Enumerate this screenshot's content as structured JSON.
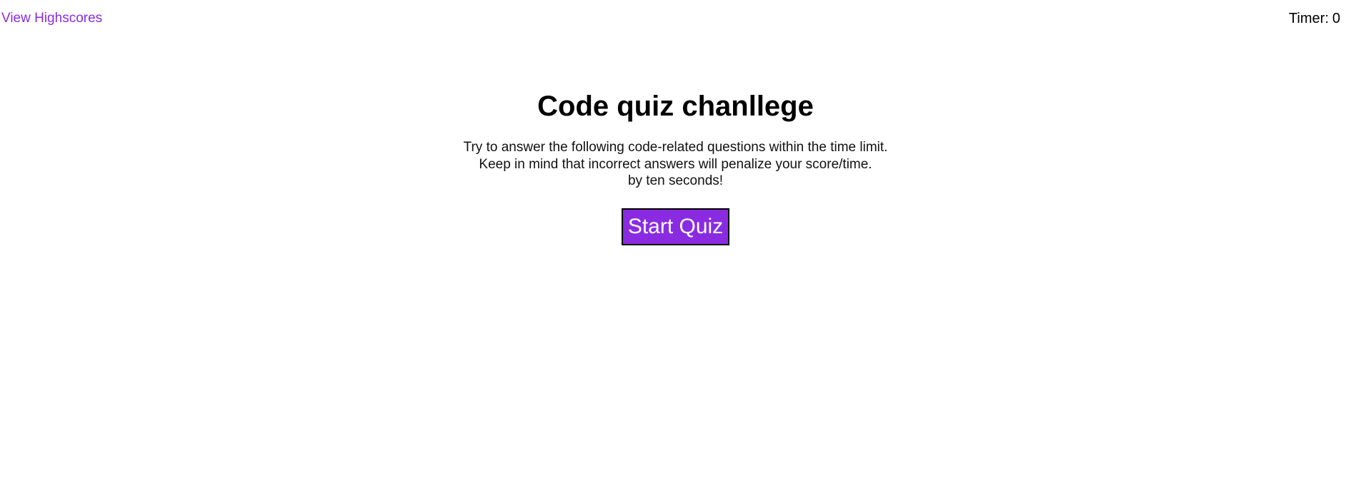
{
  "header": {
    "highscores_link": "View Highscores",
    "timer_label": "Timer:",
    "timer_value": "0"
  },
  "main": {
    "title": "Code quiz chanllege",
    "instructions": [
      "Try to answer the following code-related questions within the time limit.",
      "Keep in mind that incorrect answers will penalize your score/time.",
      "by ten seconds!"
    ],
    "start_button_label": "Start Quiz"
  },
  "colors": {
    "accent": "#8a2be2",
    "text": "#000000",
    "background": "#ffffff"
  }
}
